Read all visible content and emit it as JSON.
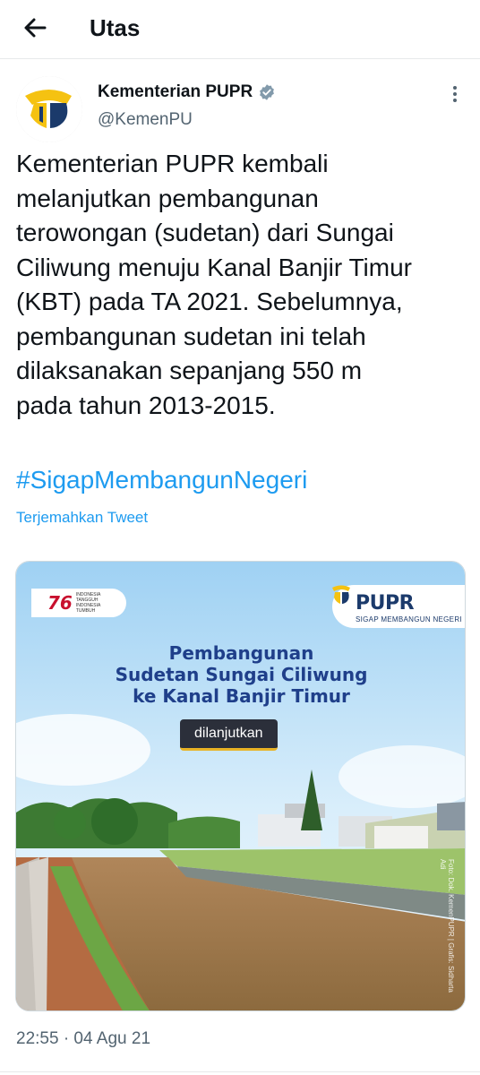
{
  "header": {
    "back_icon": "arrow-left-icon",
    "title": "Utas"
  },
  "tweet": {
    "author_name": "Kementerian PUPR",
    "verified_icon": "verified-badge-icon",
    "handle": "@KemenPU",
    "more_icon": "more-vertical-icon",
    "text": "Kementerian PUPR kembali\nmelanjutkan pembangunan\nterowongan (sudetan) dari Sungai\nCiliwung menuju Kanal Banjir Timur\n(KBT) pada TA 2021. Sebelumnya,\npembangunan sudetan ini telah\ndilaksanakan sepanjang 550 m\npada tahun 2013-2015.",
    "hashtag": "#SigapMembangunNegeri",
    "translate_link": "Terjemahkan Tweet",
    "timestamp": "22:55 · 04 Agu 21"
  },
  "media": {
    "badge_number": "76",
    "badge_small_text": "INDONESIA TANGGUH INDONESIA TUMBUH",
    "logo_text": "PUPR",
    "logo_tagline": "SIGAP MEMBANGUN NEGERI",
    "headline_1": "Pembangunan",
    "headline_2": "Sudetan Sungai Ciliwung",
    "headline_3": "ke Kanal Banjir Timur",
    "pill_label": "dilanjutkan",
    "credit": "Foto: Dok. KemenPUPR | Grafis: Sidharta Adi"
  },
  "colors": {
    "link": "#1d9bf0",
    "secondary": "#536471",
    "verified": "#829aab",
    "brand_yellow": "#f5c211",
    "brand_navy": "#1b3a6b"
  }
}
